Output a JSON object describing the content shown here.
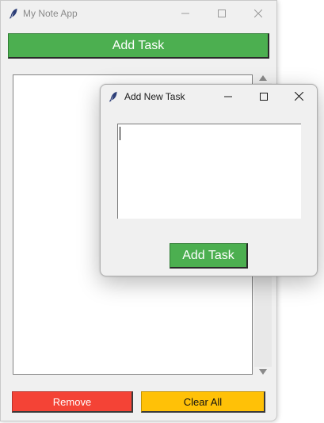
{
  "main_window": {
    "title": "My Note App",
    "add_task_label": "Add Task",
    "remove_label": "Remove",
    "clear_all_label": "Clear All"
  },
  "dialog": {
    "title": "Add New Task",
    "textarea_value": "",
    "add_task_label": "Add Task"
  },
  "icons": {
    "app": "feather-icon",
    "minimize": "minimize-icon",
    "maximize": "maximize-icon",
    "close": "close-icon"
  },
  "colors": {
    "add_task": "#4caf50",
    "remove": "#f44336",
    "clear_all": "#ffc107",
    "window_bg": "#f0f0f0"
  }
}
